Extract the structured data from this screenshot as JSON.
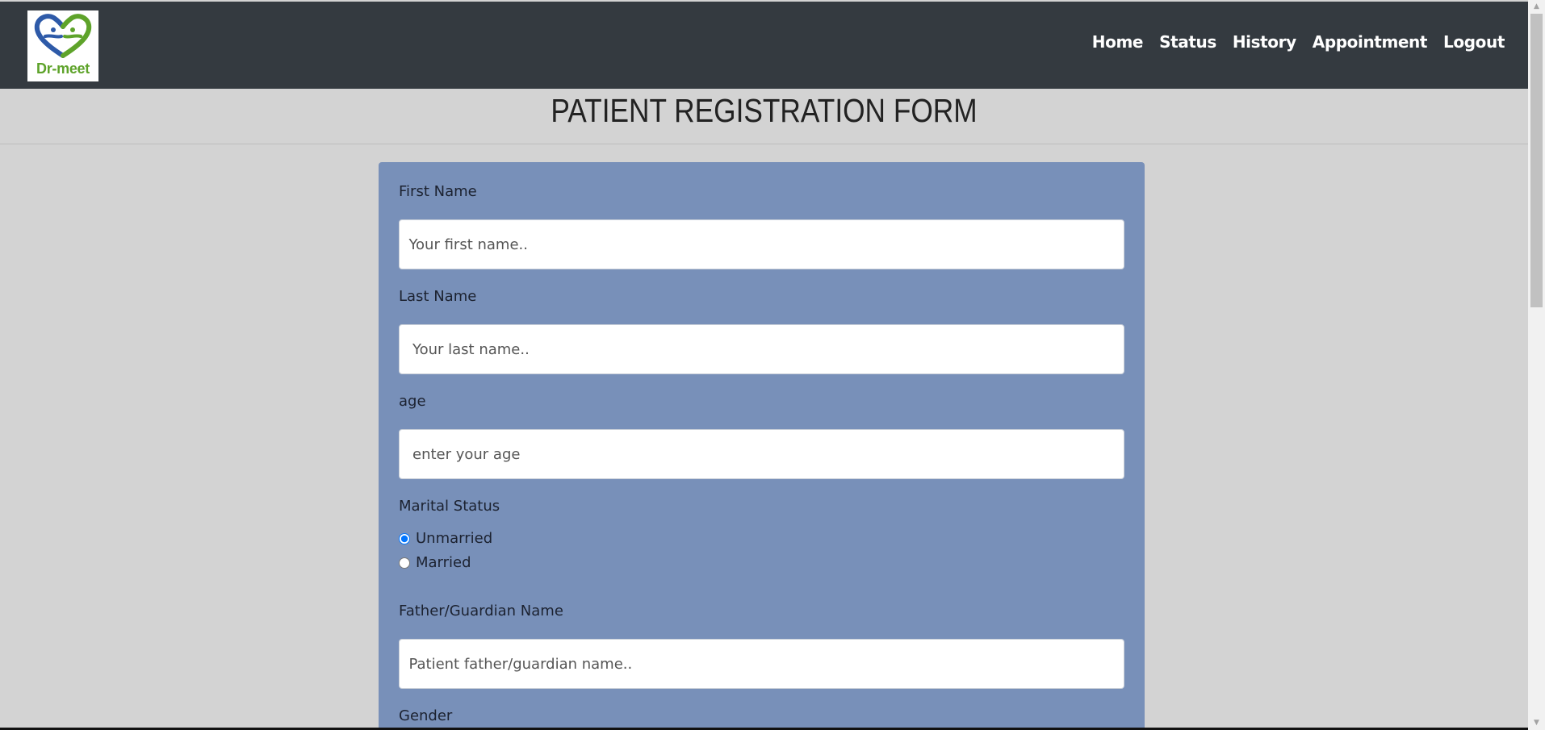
{
  "brand": {
    "name": "Dr-meet",
    "logo_icon": "heart-hands-icon"
  },
  "nav": {
    "items": [
      {
        "label": "Home"
      },
      {
        "label": "Status"
      },
      {
        "label": "History"
      },
      {
        "label": "Appointment"
      },
      {
        "label": "Logout"
      }
    ]
  },
  "page": {
    "title": "PATIENT REGISTRATION FORM"
  },
  "form": {
    "first_name": {
      "label": "First Name",
      "placeholder": "  Your first name.."
    },
    "last_name": {
      "label": "Last Name",
      "placeholder": "Your last name.."
    },
    "age": {
      "label": "age",
      "placeholder": "enter your age"
    },
    "marital_status": {
      "label": "Marital Status",
      "options": [
        {
          "label": "Unmarried",
          "checked": true
        },
        {
          "label": "Married",
          "checked": false
        }
      ]
    },
    "guardian": {
      "label": "Father/Guardian Name",
      "placeholder": "  Patient father/guardian name.."
    },
    "gender": {
      "label": "Gender"
    }
  },
  "colors": {
    "navbar": "#343a40",
    "background": "#d3d3d3",
    "form_panel": "#7890b9",
    "logo_green": "#5ea32a",
    "logo_blue": "#2e5aa8"
  }
}
